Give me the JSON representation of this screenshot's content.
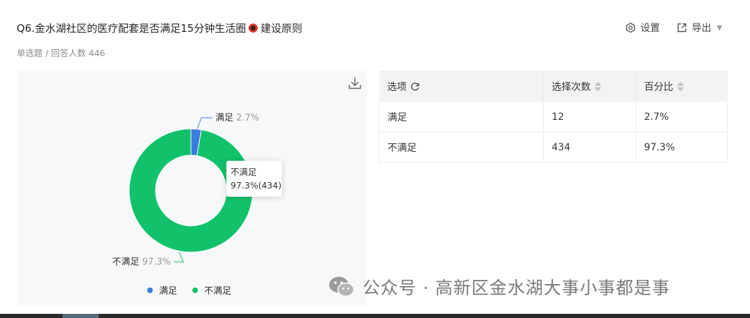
{
  "question": {
    "title_before": "Q6.金水湖社区的医疗配套是否满足15分钟生活圈",
    "title_after": "建设原则",
    "meta": "单选题 / 回答人数 446"
  },
  "toolbar": {
    "settings_label": "设置",
    "export_label": "导出"
  },
  "tooltip": {
    "label": "不满足",
    "value": "97.3%(434)"
  },
  "table": {
    "headers": [
      "选项",
      "选择次数",
      "百分比"
    ],
    "rows": [
      [
        "满足",
        "12",
        "2.7%"
      ],
      [
        "不满足",
        "434",
        "97.3%"
      ]
    ]
  },
  "chart_data": {
    "type": "pie",
    "variant": "donut",
    "categories": [
      "满足",
      "不满足"
    ],
    "values": [
      12,
      434
    ],
    "percentages": [
      "2.7%",
      "97.3%"
    ],
    "colors": [
      "#3a7be0",
      "#12c26a"
    ],
    "legend": [
      "满足",
      "不满足"
    ],
    "legend_position": "bottom"
  },
  "watermark": {
    "text": "公众号 · 高新区金水湖大事小事都是事"
  }
}
